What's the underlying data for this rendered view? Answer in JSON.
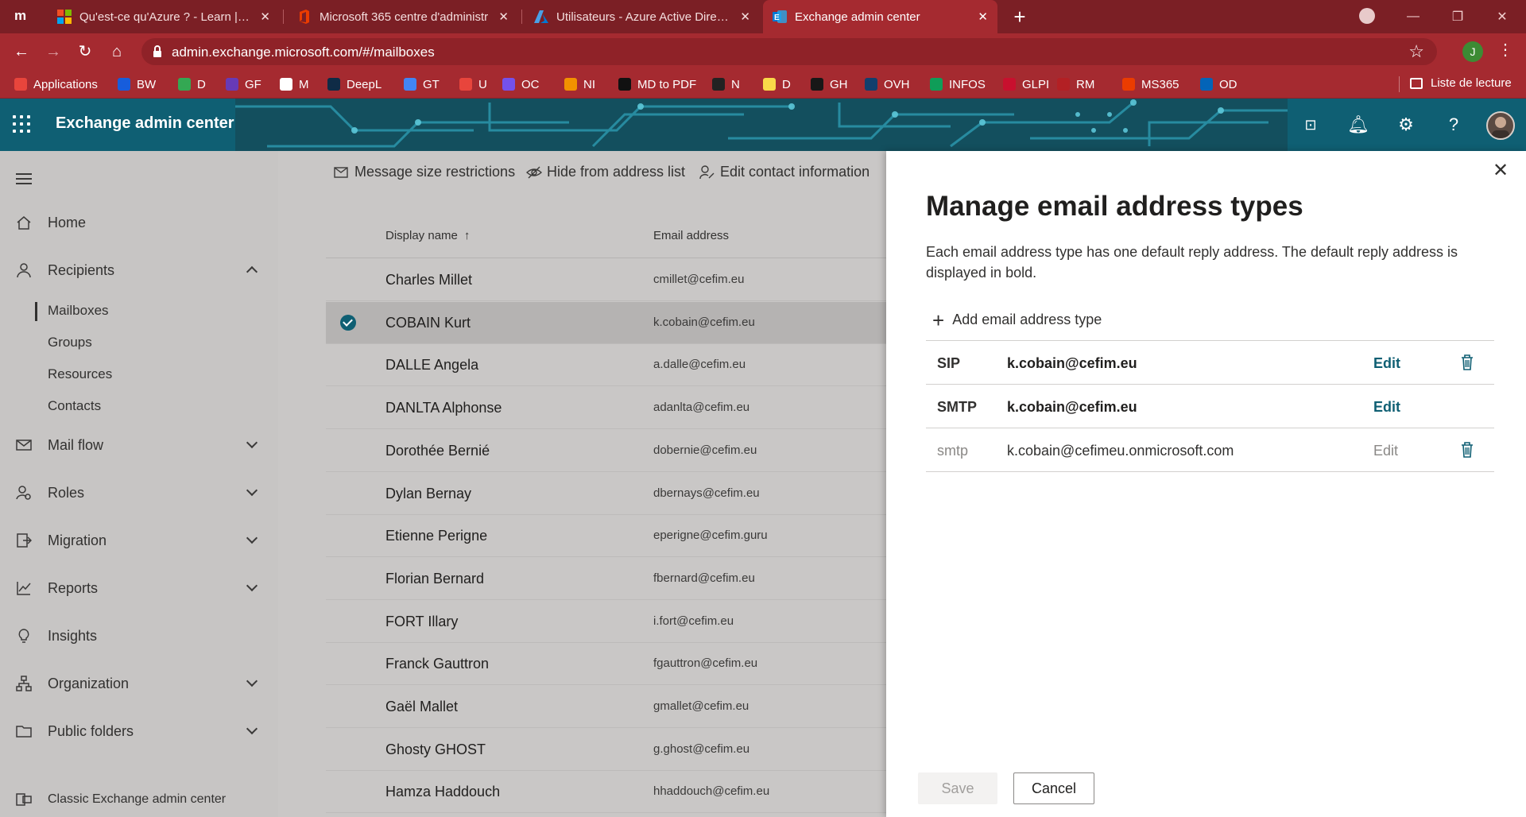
{
  "browser": {
    "tabs": [
      {
        "label": "Qu'est-ce qu'Azure ? - Learn | Mi",
        "favicon": "microsoft-logo-icon"
      },
      {
        "label": "Microsoft 365 centre d'administr",
        "favicon": "office-logo-icon"
      },
      {
        "label": "Utilisateurs - Azure Active Directo",
        "favicon": "azure-logo-icon"
      },
      {
        "label": "Exchange admin center",
        "favicon": "exchange-logo-icon"
      }
    ],
    "url": "admin.exchange.microsoft.com/#/mailboxes",
    "profile_initial": "J",
    "bookmarks": [
      {
        "label": "Applications",
        "color": "#e8453c"
      },
      {
        "label": "BW",
        "color": "#175ddc"
      },
      {
        "label": "D",
        "color": "#34a853"
      },
      {
        "label": "GF",
        "color": "#673ab7"
      },
      {
        "label": "M",
        "color": "#ffffff"
      },
      {
        "label": "DeepL",
        "color": "#0f2b46"
      },
      {
        "label": "GT",
        "color": "#4285f4"
      },
      {
        "label": "U",
        "color": "#e8453c"
      },
      {
        "label": "OC",
        "color": "#7451eb"
      },
      {
        "label": "NI",
        "color": "#f29100"
      },
      {
        "label": "MD to PDF",
        "color": "#111111"
      },
      {
        "label": "N",
        "color": "#222222"
      },
      {
        "label": "D",
        "color": "#f9d849"
      },
      {
        "label": "GH",
        "color": "#181717"
      },
      {
        "label": "OVH",
        "color": "#123f6d"
      },
      {
        "label": "INFOS",
        "color": "#0f9d58"
      },
      {
        "label": "GLPI",
        "color": "#c8102e"
      },
      {
        "label": "RM",
        "color": "#b32024"
      },
      {
        "label": "MS365",
        "color": "#eb3c00"
      },
      {
        "label": "OD",
        "color": "#0364b8"
      }
    ],
    "reading_list": "Liste de lecture"
  },
  "header": {
    "title": "Exchange admin center"
  },
  "nav": {
    "home": "Home",
    "recipients": "Recipients",
    "sub": {
      "mailboxes": "Mailboxes",
      "groups": "Groups",
      "resources": "Resources",
      "contacts": "Contacts"
    },
    "mail_flow": "Mail flow",
    "roles": "Roles",
    "migration": "Migration",
    "reports": "Reports",
    "insights": "Insights",
    "organization": "Organization",
    "public_folders": "Public folders",
    "classic": "Classic Exchange admin center"
  },
  "commands": {
    "message_size": "Message size restrictions",
    "hide": "Hide from address list",
    "edit_contact": "Edit contact information"
  },
  "list": {
    "col_display": "Display name",
    "col_email": "Email address",
    "sort": "↑",
    "rows": [
      {
        "name": "Charles Millet",
        "email": "cmillet@cefim.eu"
      },
      {
        "name": "COBAIN Kurt",
        "email": "k.cobain@cefim.eu"
      },
      {
        "name": "DALLE Angela",
        "email": "a.dalle@cefim.eu"
      },
      {
        "name": "DANLTA Alphonse",
        "email": "adanlta@cefim.eu"
      },
      {
        "name": "Dorothée Bernié",
        "email": "dobernie@cefim.eu"
      },
      {
        "name": "Dylan Bernay",
        "email": "dbernays@cefim.eu"
      },
      {
        "name": "Etienne Perigne",
        "email": "eperigne@cefim.guru"
      },
      {
        "name": "Florian Bernard",
        "email": "fbernard@cefim.eu"
      },
      {
        "name": "FORT Illary",
        "email": "i.fort@cefim.eu"
      },
      {
        "name": "Franck Gauttron",
        "email": "fgauttron@cefim.eu"
      },
      {
        "name": "Gaël Mallet",
        "email": "gmallet@cefim.eu"
      },
      {
        "name": "Ghosty GHOST",
        "email": "g.ghost@cefim.eu"
      },
      {
        "name": "Hamza Haddouch",
        "email": "hhaddouch@cefim.eu"
      }
    ]
  },
  "panel": {
    "title": "Manage email address types",
    "description": "Each email address type has one default reply address. The default reply address is displayed in bold.",
    "add_label": "Add email address type",
    "addresses": [
      {
        "type": "SIP",
        "value": "k.cobain@cefim.eu",
        "edit": "Edit"
      },
      {
        "type": "SMTP",
        "value": "k.cobain@cefim.eu",
        "edit": "Edit"
      },
      {
        "type": "smtp",
        "value": "k.cobain@cefimeu.onmicrosoft.com",
        "edit": "Edit"
      }
    ],
    "save": "Save",
    "cancel": "Cancel"
  }
}
